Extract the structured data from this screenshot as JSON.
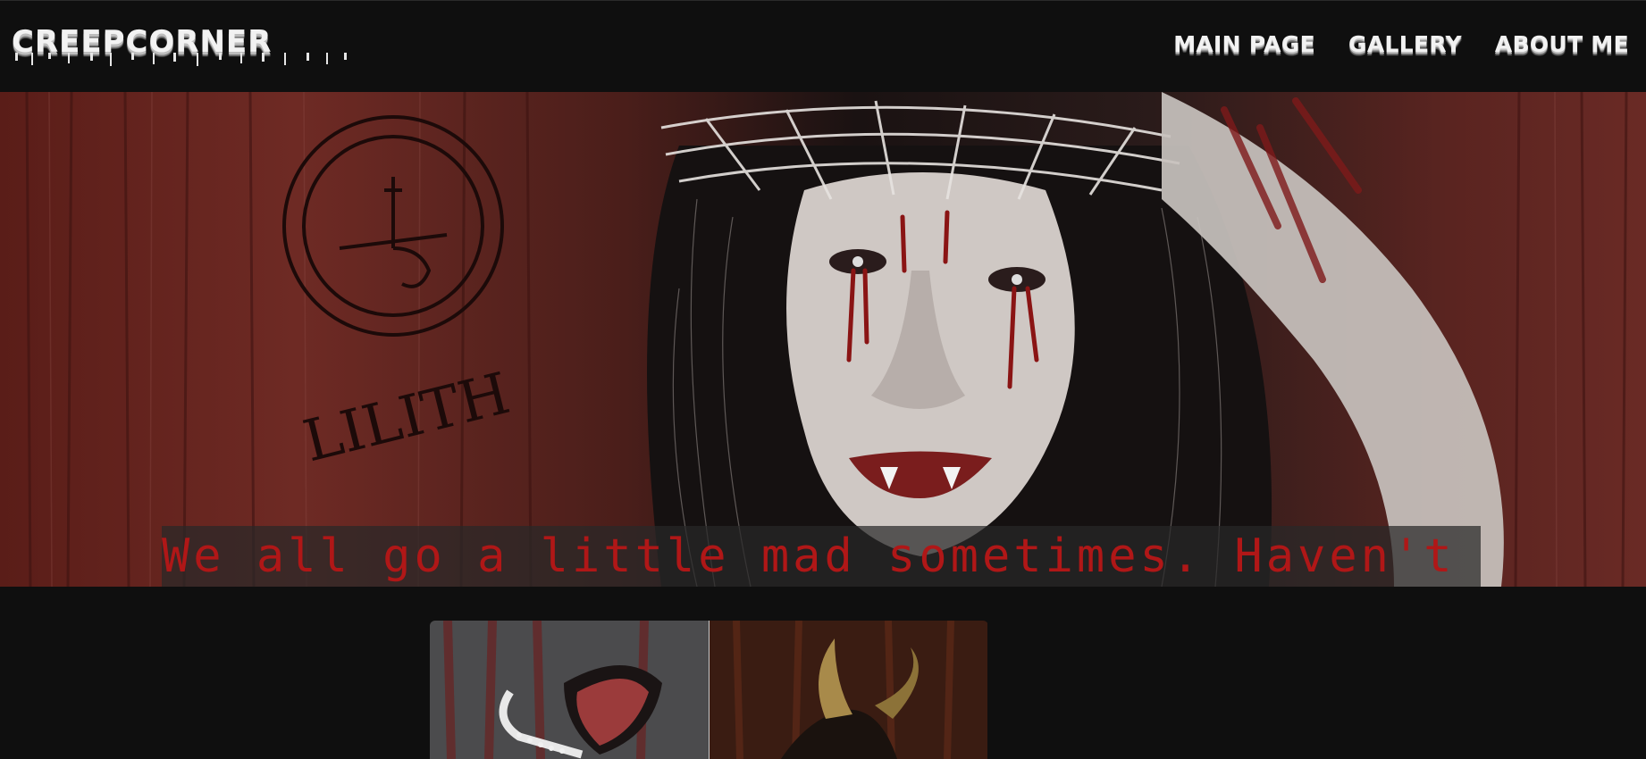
{
  "site": {
    "logo": "CREEPCORNER"
  },
  "nav": {
    "items": [
      {
        "label": "MAIN PAGE"
      },
      {
        "label": "GALLERY"
      },
      {
        "label": "ABOUT ME"
      }
    ]
  },
  "hero": {
    "quote": "We all go a little mad sometimes. Haven't",
    "painted_text": "LILITH"
  },
  "colors": {
    "background": "#0f0f0f",
    "quote_text": "#b01717",
    "nav_text": "#f2f2f2"
  }
}
